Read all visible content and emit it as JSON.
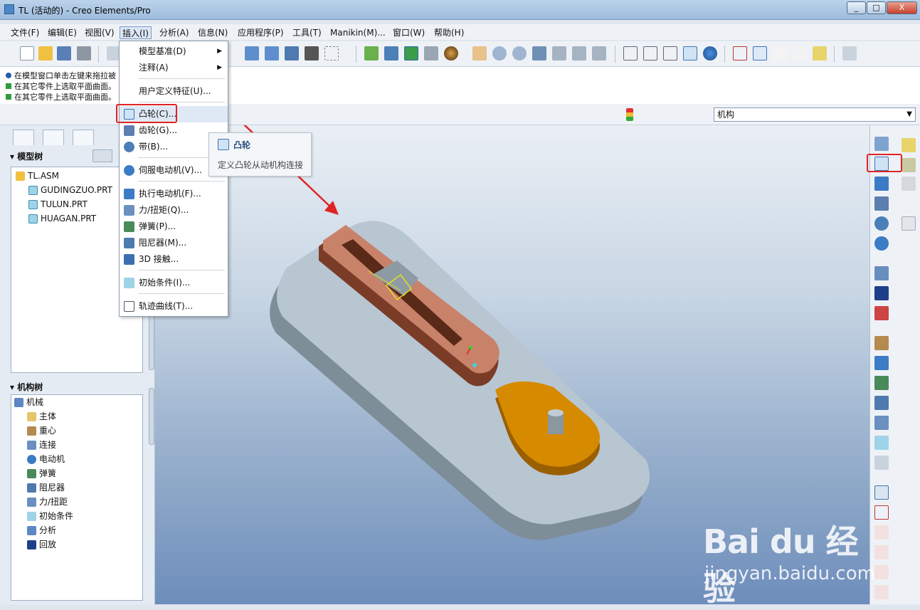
{
  "window": {
    "title": "TL (活动的) - Creo Elements/Pro",
    "min_label": "_",
    "max_label": "□",
    "close_label": "X"
  },
  "menubar": [
    {
      "label": "文件(F)"
    },
    {
      "label": "编辑(E)"
    },
    {
      "label": "视图(V)"
    },
    {
      "label": "插入(I)"
    },
    {
      "label": "分析(A)"
    },
    {
      "label": "信息(N)"
    },
    {
      "label": "应用程序(P)"
    },
    {
      "label": "工具(T)"
    },
    {
      "label": "Manikin(M)..."
    },
    {
      "label": "窗口(W)"
    },
    {
      "label": "帮助(H)"
    }
  ],
  "messages": [
    {
      "text": "在模型窗口单击左键来拖拉被",
      "icon": "dot-icon"
    },
    {
      "text": "在其它零件上选取平面曲面。",
      "icon": "green-arrow-icon"
    },
    {
      "text": "在其它零件上选取平面曲面。",
      "icon": "green-arrow-icon"
    }
  ],
  "filter_select": {
    "value": "机构"
  },
  "model_tree": {
    "header": "模型树",
    "items": [
      {
        "label": "TL.ASM"
      },
      {
        "label": "GUDINGZUO.PRT"
      },
      {
        "label": "TULUN.PRT"
      },
      {
        "label": "HUAGAN.PRT"
      }
    ]
  },
  "mech_tree": {
    "header": "机构树",
    "items": [
      {
        "label": "机械"
      },
      {
        "label": "主体"
      },
      {
        "label": "重心"
      },
      {
        "label": "连接"
      },
      {
        "label": "电动机"
      },
      {
        "label": "弹簧"
      },
      {
        "label": "阻尼器"
      },
      {
        "label": "力/扭距"
      },
      {
        "label": "初始条件"
      },
      {
        "label": "分析"
      },
      {
        "label": "回放"
      }
    ]
  },
  "insert_menu": {
    "items": [
      {
        "label": "模型基准(D)",
        "submenu": true
      },
      {
        "label": "注释(A)",
        "submenu": true
      },
      {
        "label": "用户定义特征(U)..."
      },
      {
        "label": "凸轮(C)..."
      },
      {
        "label": "齿轮(G)..."
      },
      {
        "label": "带(B)..."
      },
      {
        "label": "伺服电动机(V)..."
      },
      {
        "label": "执行电动机(F)..."
      },
      {
        "label": "力/扭矩(Q)..."
      },
      {
        "label": "弹簧(P)..."
      },
      {
        "label": "阻尼器(M)..."
      },
      {
        "label": "3D 接触..."
      },
      {
        "label": "初始条件(I)..."
      },
      {
        "label": "轨迹曲线(T)..."
      }
    ],
    "submenu_glyph": "▶"
  },
  "tooltip": {
    "title": "凸轮",
    "description": "定义凸轮从动机构连接"
  },
  "watermark": {
    "logo": "Bai du 经验",
    "url": "jingyan.baidu.com"
  },
  "colors": {
    "accent_red": "#e02424",
    "cam_orange": "#d68a00",
    "slider_copper": "#c9826a",
    "base_plate": "#b8c6d2"
  }
}
